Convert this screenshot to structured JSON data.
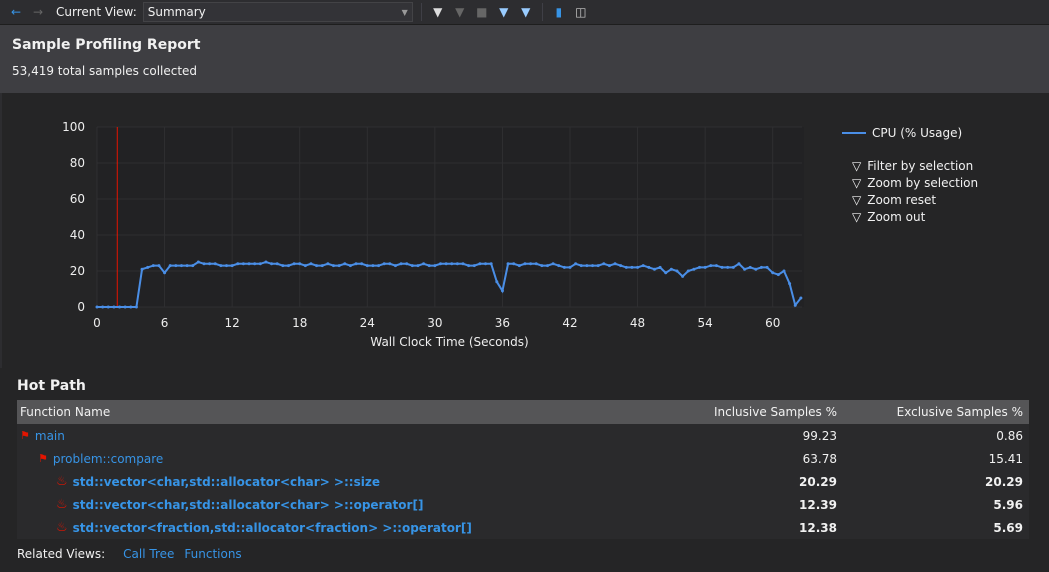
{
  "toolbar": {
    "current_view_label": "Current View:",
    "current_view_value": "Summary",
    "icons": [
      "back-arrow",
      "forward-arrow",
      "filter",
      "clear-filter",
      "stop",
      "filter-link",
      "filter-refresh",
      "save",
      "export"
    ]
  },
  "header": {
    "title": "Sample Profiling Report",
    "subtitle": "53,419 total samples collected"
  },
  "colors": {
    "line": "#4a8ee6",
    "marker": "#e51400",
    "link": "#3794e6"
  },
  "chart_data": {
    "type": "line",
    "title": "",
    "xlabel": "Wall Clock Time (Seconds)",
    "ylabel": "",
    "xlim": [
      0,
      63
    ],
    "ylim": [
      0,
      100
    ],
    "grid": true,
    "legend": "right",
    "xticks": [
      0,
      6,
      12,
      18,
      24,
      30,
      36,
      42,
      48,
      54,
      60
    ],
    "yticks": [
      0,
      20,
      40,
      60,
      80,
      100
    ],
    "selection_marker_x": 1.8,
    "series": [
      {
        "name": "CPU (% Usage)",
        "points": [
          [
            0,
            0
          ],
          [
            0.5,
            0
          ],
          [
            1,
            0
          ],
          [
            1.5,
            0
          ],
          [
            2,
            0
          ],
          [
            2.5,
            0
          ],
          [
            3,
            0
          ],
          [
            3.5,
            0
          ],
          [
            4,
            21
          ],
          [
            4.5,
            22
          ],
          [
            5,
            23
          ],
          [
            5.5,
            23
          ],
          [
            6,
            19
          ],
          [
            6.5,
            23
          ],
          [
            7,
            23
          ],
          [
            7.5,
            23
          ],
          [
            8,
            23
          ],
          [
            8.5,
            23
          ],
          [
            9,
            25
          ],
          [
            9.5,
            24
          ],
          [
            10,
            24
          ],
          [
            10.5,
            24
          ],
          [
            11,
            23
          ],
          [
            11.5,
            23
          ],
          [
            12,
            23
          ],
          [
            12.5,
            24
          ],
          [
            13,
            24
          ],
          [
            13.5,
            24
          ],
          [
            14,
            24
          ],
          [
            14.5,
            24
          ],
          [
            15,
            25
          ],
          [
            15.5,
            24
          ],
          [
            16,
            24
          ],
          [
            16.5,
            23
          ],
          [
            17,
            23
          ],
          [
            17.5,
            24
          ],
          [
            18,
            24
          ],
          [
            18.5,
            23
          ],
          [
            19,
            24
          ],
          [
            19.5,
            23
          ],
          [
            20,
            23
          ],
          [
            20.5,
            24
          ],
          [
            21,
            23
          ],
          [
            21.5,
            23
          ],
          [
            22,
            24
          ],
          [
            22.5,
            23
          ],
          [
            23,
            24
          ],
          [
            23.5,
            24
          ],
          [
            24,
            23
          ],
          [
            24.5,
            23
          ],
          [
            25,
            23
          ],
          [
            25.5,
            24
          ],
          [
            26,
            24
          ],
          [
            26.5,
            23
          ],
          [
            27,
            24
          ],
          [
            27.5,
            24
          ],
          [
            28,
            23
          ],
          [
            28.5,
            23
          ],
          [
            29,
            24
          ],
          [
            29.5,
            23
          ],
          [
            30,
            23
          ],
          [
            30.5,
            24
          ],
          [
            31,
            24
          ],
          [
            31.5,
            24
          ],
          [
            32,
            24
          ],
          [
            32.5,
            24
          ],
          [
            33,
            23
          ],
          [
            33.5,
            23
          ],
          [
            34,
            24
          ],
          [
            34.5,
            24
          ],
          [
            35,
            24
          ],
          [
            35.5,
            14
          ],
          [
            36,
            9
          ],
          [
            36.5,
            24
          ],
          [
            37,
            24
          ],
          [
            37.5,
            23
          ],
          [
            38,
            24
          ],
          [
            38.5,
            24
          ],
          [
            39,
            24
          ],
          [
            39.5,
            23
          ],
          [
            40,
            23
          ],
          [
            40.5,
            24
          ],
          [
            41,
            23
          ],
          [
            41.5,
            22
          ],
          [
            42,
            22
          ],
          [
            42.5,
            24
          ],
          [
            43,
            23
          ],
          [
            43.5,
            23
          ],
          [
            44,
            23
          ],
          [
            44.5,
            23
          ],
          [
            45,
            24
          ],
          [
            45.5,
            23
          ],
          [
            46,
            24
          ],
          [
            46.5,
            23
          ],
          [
            47,
            22
          ],
          [
            47.5,
            22
          ],
          [
            48,
            22
          ],
          [
            48.5,
            23
          ],
          [
            49,
            22
          ],
          [
            49.5,
            21
          ],
          [
            50,
            22
          ],
          [
            50.5,
            19
          ],
          [
            51,
            21
          ],
          [
            51.5,
            20
          ],
          [
            52,
            17
          ],
          [
            52.5,
            20
          ],
          [
            53,
            21
          ],
          [
            53.5,
            22
          ],
          [
            54,
            22
          ],
          [
            54.5,
            23
          ],
          [
            55,
            23
          ],
          [
            55.5,
            22
          ],
          [
            56,
            22
          ],
          [
            56.5,
            22
          ],
          [
            57,
            24
          ],
          [
            57.5,
            21
          ],
          [
            58,
            22
          ],
          [
            58.5,
            21
          ],
          [
            59,
            22
          ],
          [
            59.5,
            22
          ],
          [
            60,
            19
          ],
          [
            60.5,
            18
          ],
          [
            61,
            20
          ],
          [
            61.5,
            13
          ],
          [
            62,
            1
          ],
          [
            62.5,
            5
          ]
        ]
      }
    ]
  },
  "legend": {
    "series_label": "CPU (% Usage)",
    "actions": [
      "Filter by selection",
      "Zoom by selection",
      "Zoom reset",
      "Zoom out"
    ]
  },
  "hot_path": {
    "title": "Hot Path",
    "columns": [
      "Function Name",
      "Inclusive Samples %",
      "Exclusive Samples %"
    ],
    "rows": [
      {
        "name": "main",
        "inclusive": "99.23",
        "exclusive": "0.86",
        "depth": 0,
        "icon": "hot-path-icon",
        "bold": false
      },
      {
        "name": "problem::compare",
        "inclusive": "63.78",
        "exclusive": "15.41",
        "depth": 1,
        "icon": "hot-path-icon",
        "bold": false
      },
      {
        "name": "std::vector<char,std::allocator<char> >::size",
        "inclusive": "20.29",
        "exclusive": "20.29",
        "depth": 2,
        "icon": "flame-icon",
        "bold": true
      },
      {
        "name": "std::vector<char,std::allocator<char> >::operator[]",
        "inclusive": "12.39",
        "exclusive": "5.96",
        "depth": 2,
        "icon": "flame-icon",
        "bold": true
      },
      {
        "name": "std::vector<fraction,std::allocator<fraction> >::operator[]",
        "inclusive": "12.38",
        "exclusive": "5.69",
        "depth": 2,
        "icon": "flame-icon",
        "bold": true
      }
    ]
  },
  "related": {
    "label": "Related Views:",
    "links": [
      "Call Tree",
      "Functions"
    ]
  }
}
